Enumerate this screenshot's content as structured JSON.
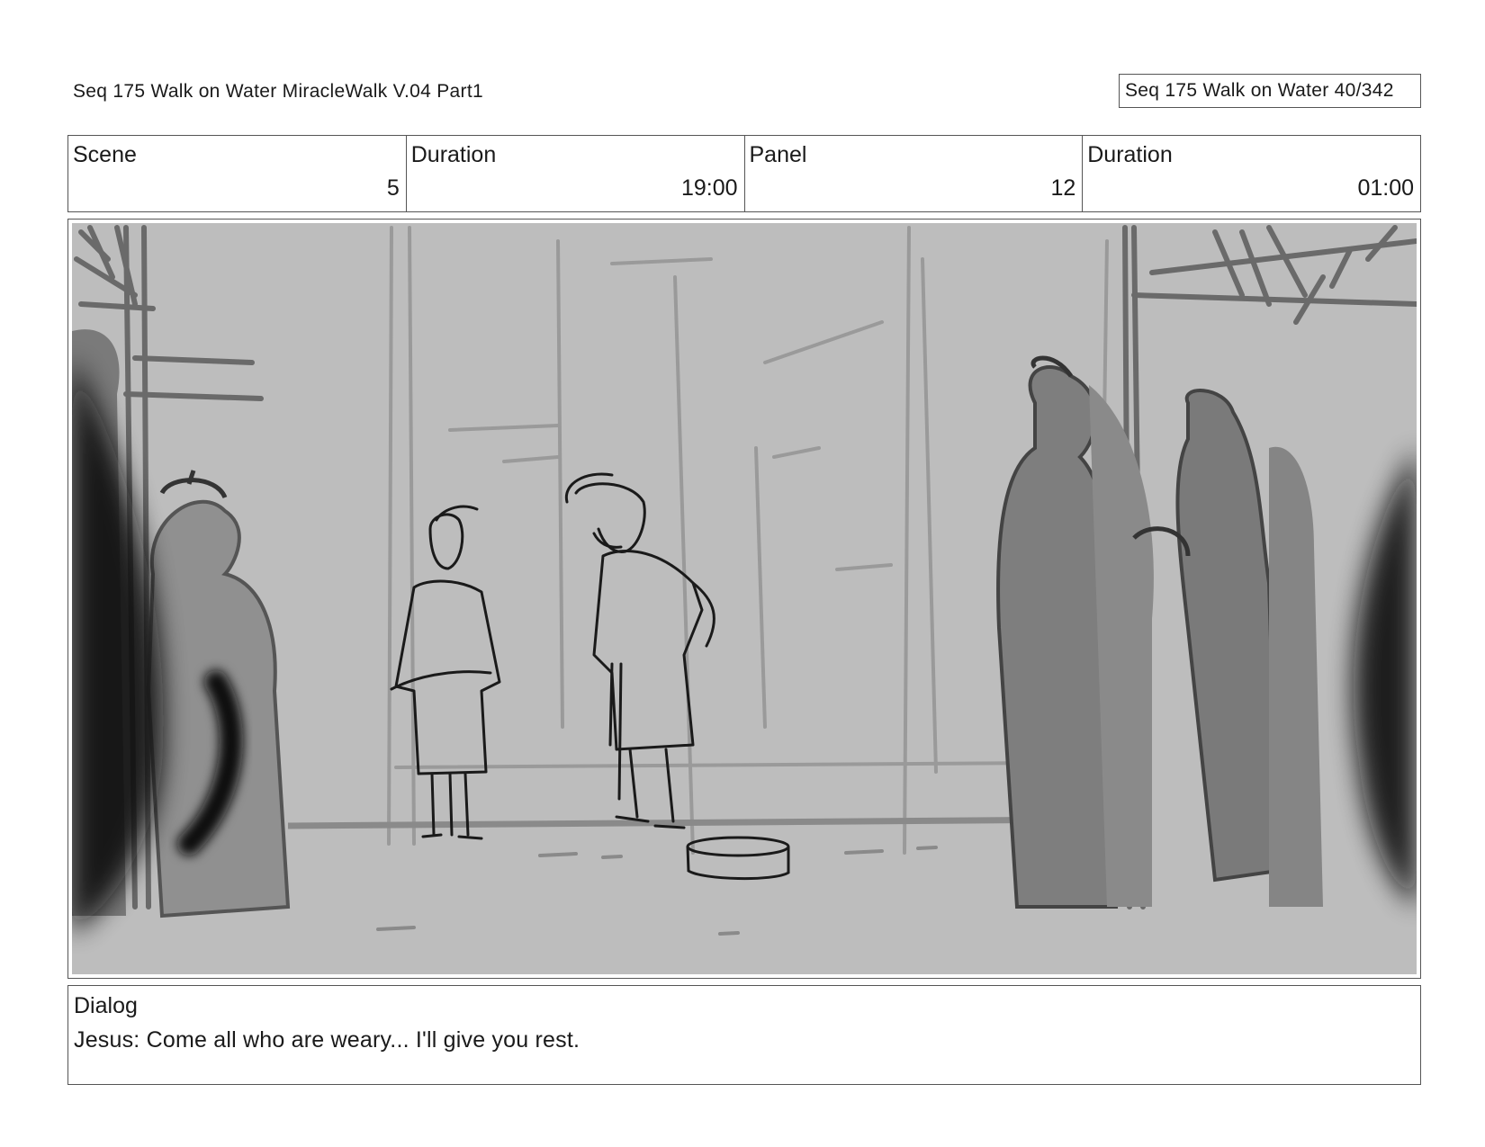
{
  "header": {
    "left_title": "Seq 175 Walk on Water  MiracleWalk V.04 Part1",
    "right_title": "Seq 175 Walk on Water  40/342"
  },
  "info": {
    "scene_label": "Scene",
    "scene_value": "5",
    "scene_duration_label": "Duration",
    "scene_duration_value": "19:00",
    "panel_label": "Panel",
    "panel_value": "12",
    "panel_duration_label": "Duration",
    "panel_duration_value": "01:00"
  },
  "dialog": {
    "label": "Dialog",
    "text": "Jesus: Come all who are weary... I'll give you rest."
  }
}
